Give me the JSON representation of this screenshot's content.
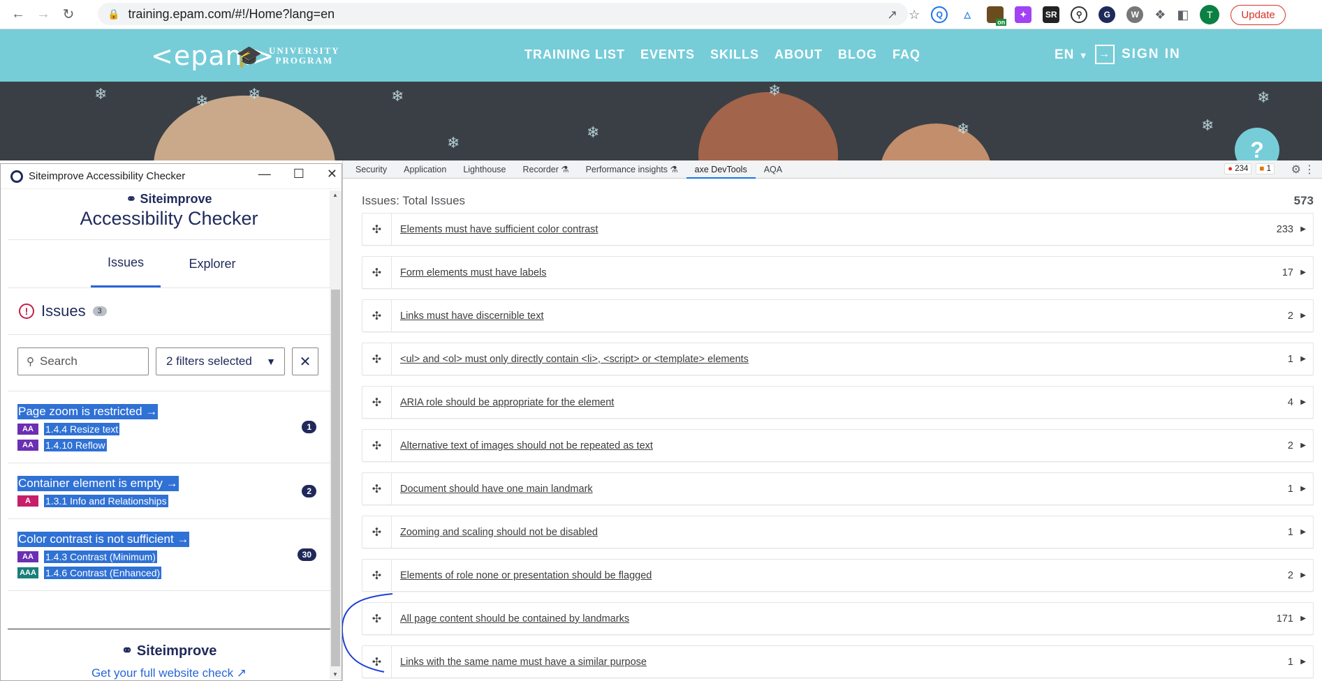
{
  "browser": {
    "url": "training.epam.com/#!/Home?lang=en",
    "update_label": "Update",
    "profile_initial": "T",
    "ext_on_label": "on",
    "ext_sr_label": "SR"
  },
  "site": {
    "logo": "<epam>",
    "logo_sub_line1": "UNIVERSITY",
    "logo_sub_line2": "PROGRAM",
    "nav": [
      "TRAINING LIST",
      "EVENTS",
      "SKILLS",
      "ABOUT",
      "BLOG",
      "FAQ"
    ],
    "lang": "EN",
    "signin": "SIGN IN",
    "help": "?"
  },
  "devtools": {
    "tabs": [
      "Security",
      "Application",
      "Lighthouse",
      "Recorder ⚗",
      "Performance insights ⚗",
      "axe DevTools",
      "AQA"
    ],
    "active_tab": "axe DevTools",
    "error_count": "234",
    "warning_count": "1",
    "issues_title": "Issues: Total Issues",
    "issues_total": "573",
    "issues": [
      {
        "title": "Elements must have sufficient color contrast",
        "count": "233"
      },
      {
        "title": "Form elements must have labels",
        "count": "17"
      },
      {
        "title": "Links must have discernible text",
        "count": "2"
      },
      {
        "title": "<ul> and <ol> must only directly contain <li>, <script> or <template> elements",
        "count": "1"
      },
      {
        "title": "ARIA role should be appropriate for the element",
        "count": "4"
      },
      {
        "title": "Alternative text of images should not be repeated as text",
        "count": "2"
      },
      {
        "title": "Document should have one main landmark",
        "count": "1"
      },
      {
        "title": "Zooming and scaling should not be disabled",
        "count": "1"
      },
      {
        "title": "Elements of role none or presentation should be flagged",
        "count": "2"
      },
      {
        "title": "All page content should be contained by landmarks",
        "count": "171"
      },
      {
        "title": "Links with the same name must have a similar purpose",
        "count": "1"
      }
    ]
  },
  "siteimprove": {
    "window_title": "Siteimprove Accessibility Checker",
    "brand": "Siteimprove",
    "heading": "Accessibility Checker",
    "tabs": [
      "Issues",
      "Explorer"
    ],
    "issues_label": "Issues",
    "issues_badge": "3",
    "search_placeholder": "Search",
    "filter_label": "2 filters selected",
    "issues": [
      {
        "title": "Page zoom is restricted →",
        "count": "1",
        "criteria": [
          {
            "level": "AA",
            "color": "#6b2fb3",
            "text": "1.4.4 Resize text"
          },
          {
            "level": "AA",
            "color": "#6b2fb3",
            "text": "1.4.10 Reflow"
          }
        ]
      },
      {
        "title": "Container element is empty →",
        "count": "2",
        "criteria": [
          {
            "level": "A",
            "color": "#c51f6a",
            "text": "1.3.1 Info and Relationships"
          }
        ]
      },
      {
        "title": "Color contrast is not sufficient →",
        "count": "30",
        "criteria": [
          {
            "level": "AA",
            "color": "#6b2fb3",
            "text": "1.4.3 Contrast (Minimum)"
          },
          {
            "level": "AAA",
            "color": "#1a7f7a",
            "text": "1.4.6 Contrast (Enhanced)"
          }
        ]
      }
    ],
    "footer_brand": "Siteimprove",
    "footer_cta": "Get your full website check ↗"
  }
}
